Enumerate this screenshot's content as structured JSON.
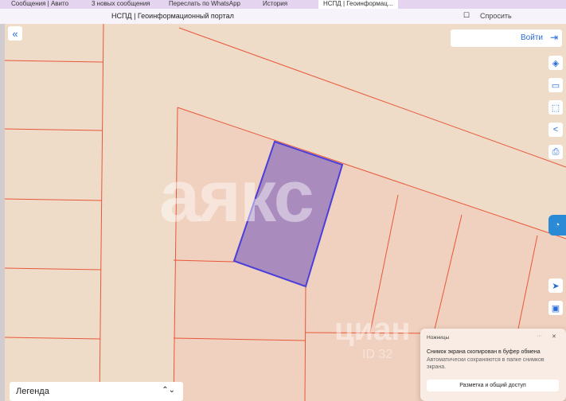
{
  "browser": {
    "tabs": [
      "Сообщения | Авито",
      "3 новых сообщения",
      "Переслать по WhatsApp",
      "История",
      "НСПД | Геоинформац..."
    ],
    "page_title": "НСПД | Геоинформационный портал",
    "ask_label": "Спросить"
  },
  "map": {
    "login_label": "Войти",
    "legend_label": "Легенда",
    "watermark": "аякс",
    "watermark2": "циан",
    "watermark3": "ID 32"
  },
  "toast": {
    "app": "Ножницы",
    "heading": "Снимок экрана скопирован в буфер обмена",
    "text": "Автоматически сохраняются в папке снимков экрана.",
    "button": "Разметка и общий доступ"
  },
  "colors": {
    "parcel_line": "#e8583a",
    "selected_fill": "#a98bbd",
    "selected_stroke": "#4a3fd8",
    "accent": "#2a6ad6"
  }
}
